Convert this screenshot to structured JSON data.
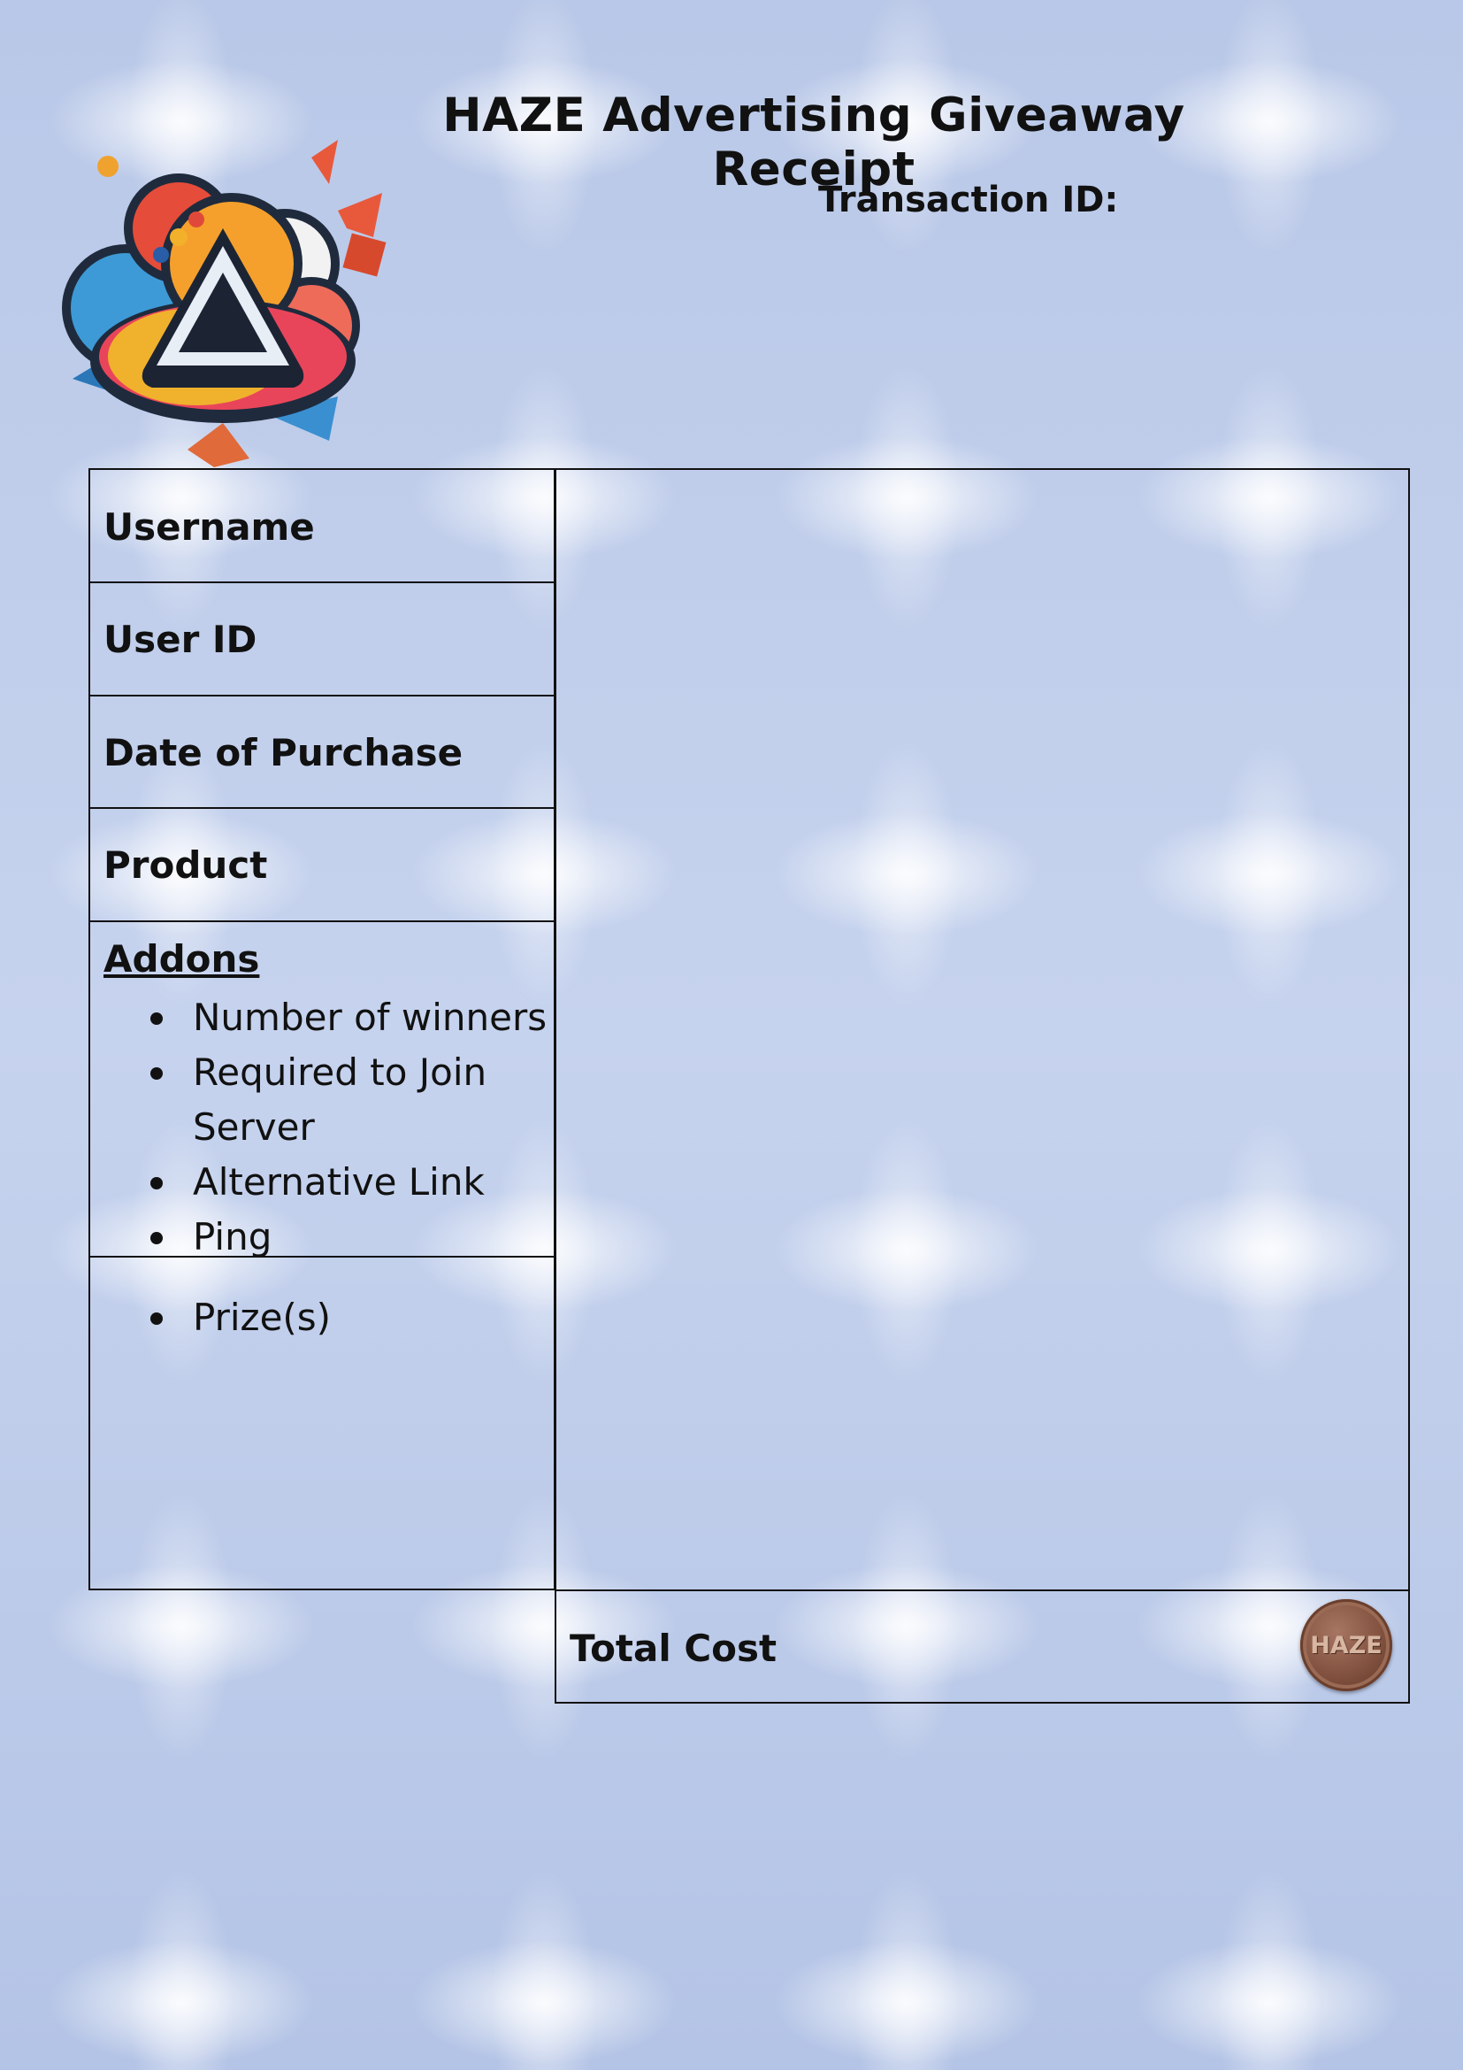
{
  "header": {
    "title": "HAZE Advertising Giveaway Receipt",
    "transaction_label": "Transaction ID:",
    "transaction_value": ""
  },
  "logo": {
    "icon": "haze-triangle-logo-icon"
  },
  "fields": [
    {
      "label": "Username",
      "value": ""
    },
    {
      "label": "User ID",
      "value": ""
    },
    {
      "label": "Date of Purchase",
      "value": ""
    },
    {
      "label": "Product",
      "value": ""
    }
  ],
  "addons": {
    "heading": "Addons",
    "items": [
      "Number of winners",
      "Required to Join Server",
      "Alternative Link",
      "Ping"
    ]
  },
  "prizes": {
    "items": [
      "Prize(s)"
    ]
  },
  "total": {
    "label": "Total Cost",
    "value": "",
    "coin_text": "HAZE"
  },
  "colors": {
    "background": "#b6c6e6",
    "border": "#111111",
    "coin": "#7e4e3c"
  }
}
